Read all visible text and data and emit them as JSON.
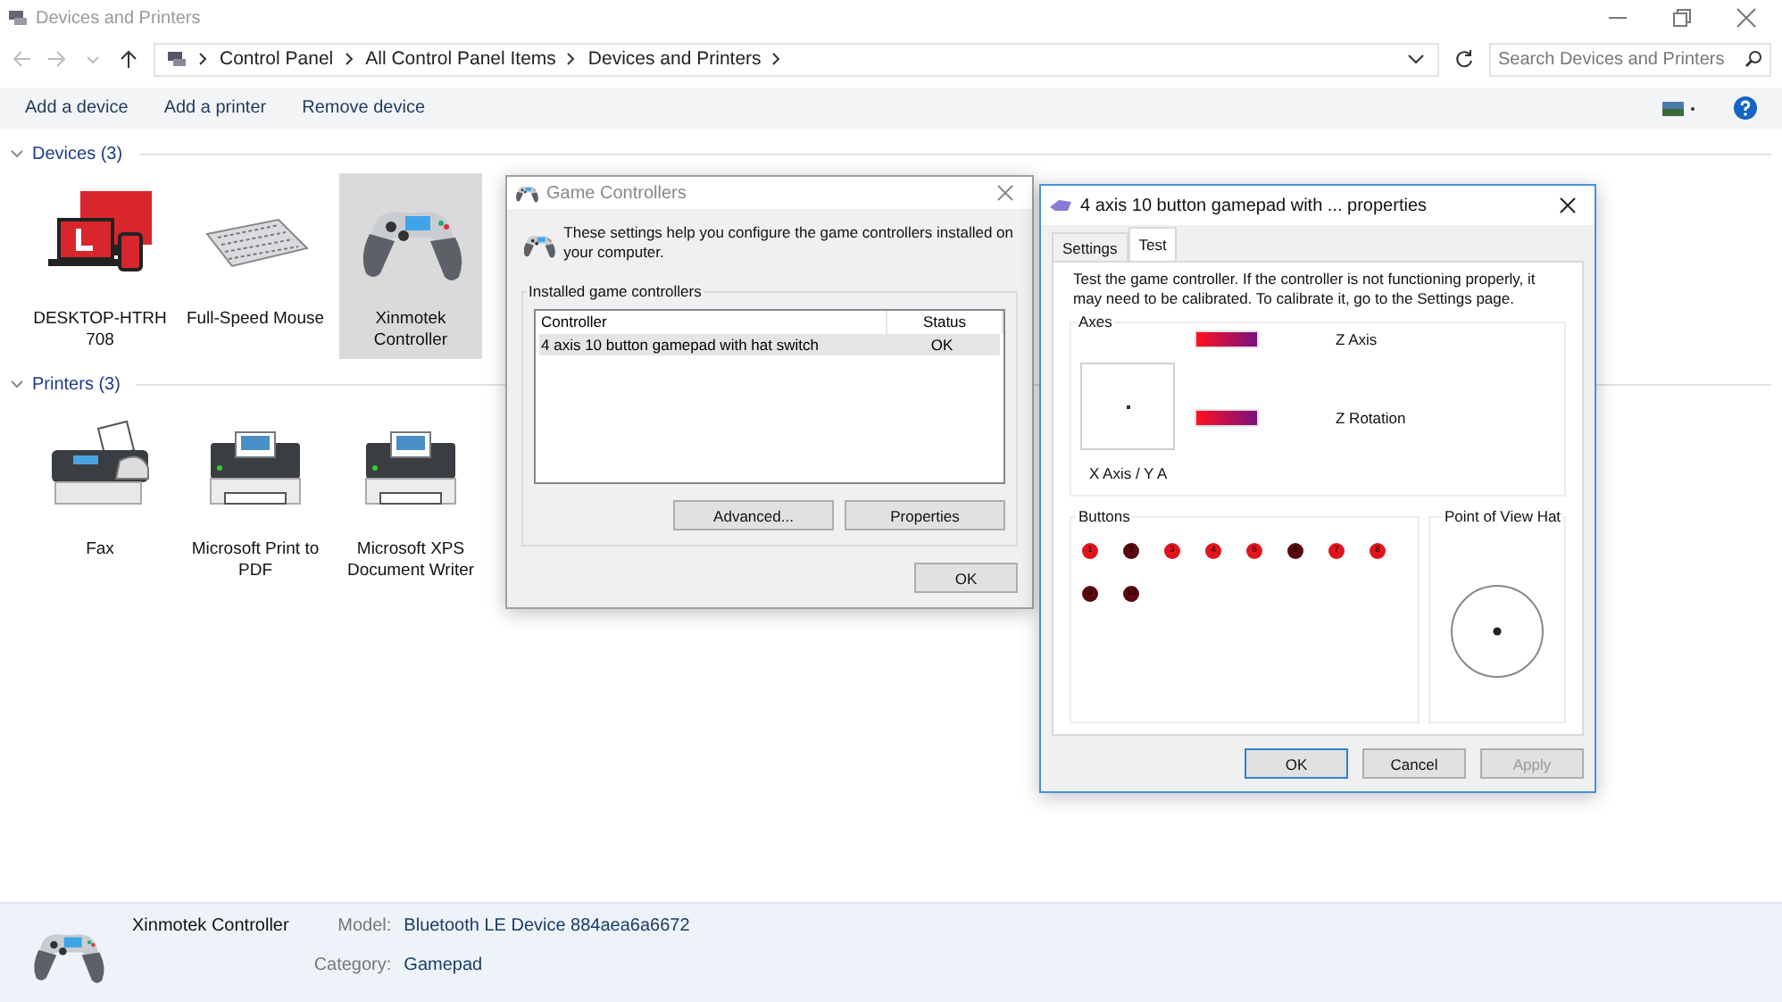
{
  "window": {
    "title": "Devices and Printers"
  },
  "address": {
    "breadcrumbs": [
      "Control Panel",
      "All Control Panel Items",
      "Devices and Printers"
    ]
  },
  "search": {
    "placeholder": "Search Devices and Printers"
  },
  "commands": [
    "Add a device",
    "Add a printer",
    "Remove device"
  ],
  "groups": [
    {
      "title": "Devices (3)",
      "expanded": true,
      "items": [
        {
          "name": "DESKTOP-HTRH708",
          "kind": "computer",
          "selected": false
        },
        {
          "name": "Full-Speed Mouse",
          "kind": "keyboard",
          "selected": false
        },
        {
          "name": "Xinmotek Controller",
          "kind": "gamepad",
          "selected": true
        }
      ]
    },
    {
      "title": "Printers (3)",
      "expanded": true,
      "items": [
        {
          "name": "Fax",
          "kind": "fax",
          "selected": false
        },
        {
          "name": "Microsoft Print to PDF",
          "kind": "printer",
          "selected": false
        },
        {
          "name": "Microsoft XPS Document Writer",
          "kind": "printer",
          "selected": false
        }
      ]
    }
  ],
  "details": {
    "name": "Xinmotek Controller",
    "fields": [
      {
        "label": "Model:",
        "value": "Bluetooth LE Device 884aea6a6672"
      },
      {
        "label": "Category:",
        "value": "Gamepad"
      }
    ]
  },
  "game_controllers": {
    "title": "Game Controllers",
    "intro": "These settings help you configure the game controllers installed on your computer.",
    "group_label": "Installed game controllers",
    "columns": [
      "Controller",
      "Status"
    ],
    "rows": [
      {
        "controller": "4 axis 10 button gamepad with hat switch",
        "status": "OK",
        "selected": true
      }
    ],
    "buttons": [
      "Advanced...",
      "Properties"
    ],
    "ok": "OK"
  },
  "properties": {
    "title": "4 axis 10 button gamepad with ... properties",
    "tabs": [
      {
        "label": "Settings",
        "selected": false
      },
      {
        "label": "Test",
        "selected": true
      }
    ],
    "description": "Test the game controller.  If the controller is not functioning properly, it may need to be calibrated.  To calibrate it, go to the Settings page.",
    "axes_label": "Axes",
    "xy_label": "X Axis / Y A",
    "bars": [
      {
        "label": "Z Axis",
        "level": 1
      },
      {
        "label": "Z Rotation",
        "level": 1
      }
    ],
    "buttons_label": "Buttons",
    "buttons": [
      {
        "label": "1",
        "color": "#e0141c"
      },
      {
        "label": "2",
        "color": "#5a0a0e"
      },
      {
        "label": "3",
        "color": "#e0141c"
      },
      {
        "label": "4",
        "color": "#e0141c"
      },
      {
        "label": "5",
        "color": "#e0141c"
      },
      {
        "label": "6",
        "color": "#5a0a0e"
      },
      {
        "label": "7",
        "color": "#e0141c"
      },
      {
        "label": "8",
        "color": "#e0141c"
      },
      {
        "label": "9",
        "color": "#5a0a0e"
      },
      {
        "label": "10",
        "color": "#5a0a0e"
      }
    ],
    "hat_label": "Point of View Hat",
    "footer": [
      {
        "label": "OK",
        "kind": "default",
        "disabled": false
      },
      {
        "label": "Cancel",
        "kind": "normal",
        "disabled": false
      },
      {
        "label": "Apply",
        "kind": "normal",
        "disabled": true
      }
    ]
  }
}
